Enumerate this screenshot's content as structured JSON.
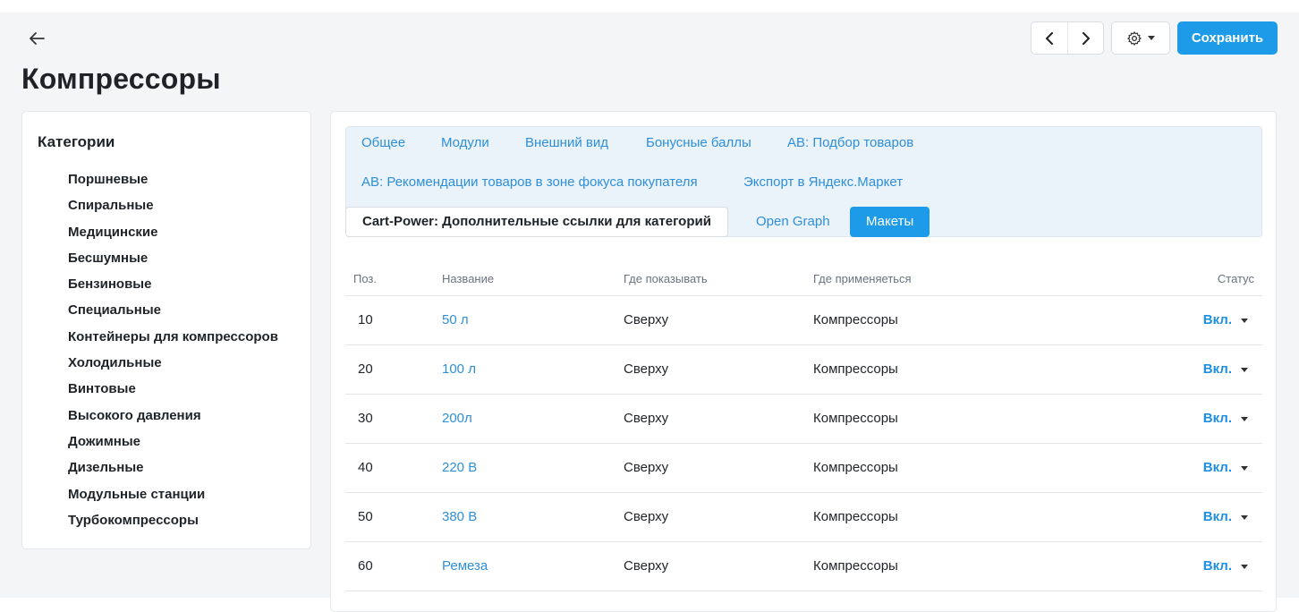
{
  "header": {
    "title": "Компрессоры",
    "save_label": "Сохранить"
  },
  "icons": {
    "back": "arrow-left-icon",
    "prev": "chevron-left-icon",
    "next": "chevron-right-icon",
    "settings": "gear-icon"
  },
  "colors": {
    "accent": "#1e9be8",
    "link": "#2f8fd8",
    "background": "#f4f5f7"
  },
  "sidebar": {
    "title": "Категории",
    "items": [
      {
        "label": "Поршневые"
      },
      {
        "label": "Спиральные"
      },
      {
        "label": "Медицинские"
      },
      {
        "label": "Бесшумные"
      },
      {
        "label": "Бензиновые"
      },
      {
        "label": "Специальные"
      },
      {
        "label": "Контейнеры для компрессоров"
      },
      {
        "label": "Холодильные"
      },
      {
        "label": "Винтовые"
      },
      {
        "label": "Высокого давления"
      },
      {
        "label": "Дожимные"
      },
      {
        "label": "Дизельные"
      },
      {
        "label": "Модульные станции"
      },
      {
        "label": "Турбокомпрессоры"
      }
    ]
  },
  "tabs": [
    {
      "label": "Общее"
    },
    {
      "label": "Модули"
    },
    {
      "label": "Внешний вид"
    },
    {
      "label": "Бонусные баллы"
    },
    {
      "label": "AB: Подбор товаров"
    },
    {
      "label": "AB: Рекомендации товаров в зоне фокуса покупателя"
    },
    {
      "label": "Экспорт в Яндекс.Маркет"
    },
    {
      "label": "Cart-Power: Дополнительные ссылки для категорий"
    },
    {
      "label": "Open Graph"
    },
    {
      "label": "Макеты"
    }
  ],
  "table": {
    "columns": {
      "pos": "Поз.",
      "name": "Название",
      "where_show": "Где показывать",
      "where_apply": "Где применяеться",
      "status": "Статус"
    },
    "rows": [
      {
        "pos": "10",
        "name": "50 л",
        "where_show": "Сверху",
        "where_apply": "Компрессоры",
        "status": "Вкл."
      },
      {
        "pos": "20",
        "name": "100 л",
        "where_show": "Сверху",
        "where_apply": "Компрессоры",
        "status": "Вкл."
      },
      {
        "pos": "30",
        "name": "200л",
        "where_show": "Сверху",
        "where_apply": "Компрессоры",
        "status": "Вкл."
      },
      {
        "pos": "40",
        "name": "220 В",
        "where_show": "Сверху",
        "where_apply": "Компрессоры",
        "status": "Вкл."
      },
      {
        "pos": "50",
        "name": "380 В",
        "where_show": "Сверху",
        "where_apply": "Компрессоры",
        "status": "Вкл."
      },
      {
        "pos": "60",
        "name": "Ремеза",
        "where_show": "Сверху",
        "where_apply": "Компрессоры",
        "status": "Вкл."
      }
    ]
  }
}
